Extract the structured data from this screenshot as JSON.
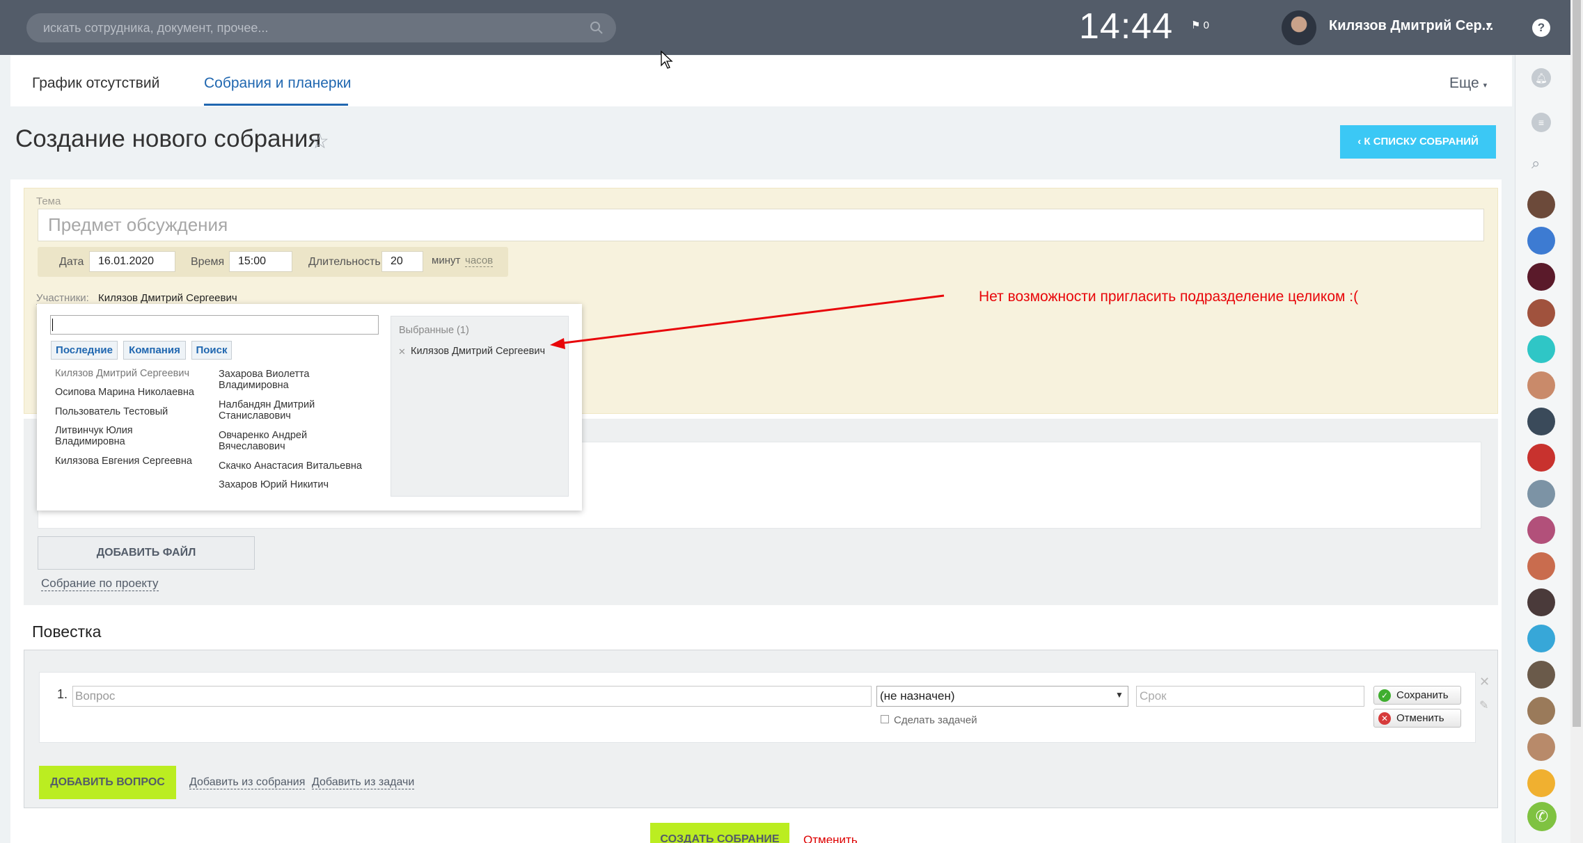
{
  "topbar": {
    "search_placeholder": "искать сотрудника, документ, прочее...",
    "clock": "14:44",
    "flag_count": "0",
    "user_name": "Килязов Дмитрий Сер...",
    "help": "?"
  },
  "tabs": {
    "items": [
      "График отсутствий",
      "Собрания и планерки"
    ],
    "selected": "Собрания и планерки",
    "more": "Еще"
  },
  "page": {
    "title": "Создание нового собрания",
    "back_button": "К СПИСКУ СОБРАНИЙ"
  },
  "form": {
    "topic_label": "Тема",
    "topic_placeholder": "Предмет обсуждения",
    "date_label": "Дата",
    "date_value": "16.01.2020",
    "time_label": "Время",
    "time_value": "15:00",
    "duration_label": "Длительность",
    "duration_value": "20",
    "unit_minutes": "минут",
    "unit_hours": "часов",
    "participants_label": "Участники:",
    "participant": "Килязов Дмитрий Сергеевич",
    "add_file": "ДОБАВИТЬ ФАЙЛ",
    "project_link": "Собрание по проекту"
  },
  "popup": {
    "tabs": [
      "Последние",
      "Компания",
      "Поиск"
    ],
    "col1": [
      "Килязов Дмитрий Сергеевич",
      "Осипова Марина Николаевна",
      "Пользователь Тестовый",
      "Литвинчук Юлия Владимировна",
      "Килязова Евгения Сергеевна"
    ],
    "col2": [
      "Захарова Виолетта Владимировна",
      "Налбандян Дмитрий Станиславович",
      "Овчаренко Андрей Вячеславович",
      "Скачко Анастасия Витальевна",
      "Захаров Юрий Никитич"
    ],
    "selected_title": "Выбранные (1)",
    "selected": [
      "Килязов Дмитрий Сергеевич"
    ]
  },
  "annotation": "Нет возможности пригласить подразделение целиком :(",
  "agenda": {
    "title": "Повестка",
    "num": "1.",
    "question_placeholder": "Вопрос",
    "responsible": "(не назначен)",
    "deadline_placeholder": "Срок",
    "make_task": "Сделать задачей",
    "save": "Сохранить",
    "cancel": "Отменить",
    "add_question": "ДОБАВИТЬ ВОПРОС",
    "add_from_meeting": "Добавить из собрания",
    "add_from_task": "Добавить из задачи"
  },
  "footer": {
    "create": "СОЗДАТЬ СОБРАНИЕ",
    "cancel": "Отменить"
  },
  "colors": {
    "topbar": "#535c69",
    "accent_blue": "#3bc8f5",
    "green": "#bbed21",
    "annotation_red": "#e8060a"
  }
}
